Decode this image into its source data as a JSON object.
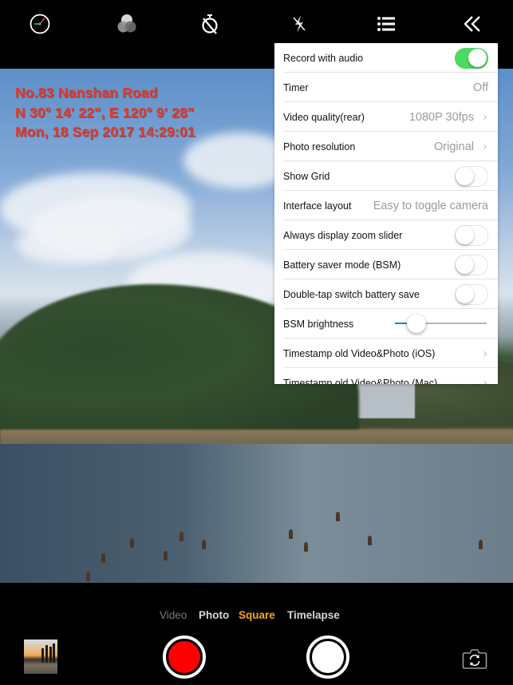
{
  "toolbar": {
    "icons": [
      "level-gauge-icon",
      "color-filter-icon",
      "timer-off-icon",
      "flash-off-icon",
      "settings-list-icon",
      "collapse-chevrons-icon"
    ]
  },
  "stamp": {
    "line1": "No.83 Nanshan Road",
    "line2": "N 30° 14' 22\", E 120° 9' 28\"",
    "line3": "Mon, 18 Sep 2017 14:29:01",
    "color": "#e23a2c"
  },
  "settings": {
    "items": [
      {
        "label": "Record with audio",
        "type": "toggle",
        "on": true
      },
      {
        "label": "Timer",
        "type": "value",
        "value": "Off"
      },
      {
        "label": "Video quality(rear)",
        "type": "value-chevron",
        "value": "1080P 30fps"
      },
      {
        "label": "Photo resolution",
        "type": "value-chevron",
        "value": "Original"
      },
      {
        "label": "Show Grid",
        "type": "toggle",
        "on": false
      },
      {
        "label": "Interface layout",
        "type": "value",
        "value": "Easy to toggle camera"
      },
      {
        "label": "Always display zoom slider",
        "type": "toggle",
        "on": false
      },
      {
        "label": "Battery saver mode (BSM)",
        "type": "toggle",
        "on": false
      },
      {
        "label": "Double-tap switch battery save",
        "type": "toggle",
        "on": false
      },
      {
        "label": "BSM brightness",
        "type": "slider",
        "value": 0.17
      },
      {
        "label": "Timestamp old Video&Photo (iOS)",
        "type": "chevron"
      },
      {
        "label": "Timestamp old Video&Photo (Mac)",
        "type": "chevron"
      }
    ],
    "toggle_on_color": "#4cd964",
    "slider_color": "#1a7cf5"
  },
  "modes": {
    "items": [
      "Video",
      "Photo",
      "Square",
      "Timelapse"
    ],
    "active": "Square",
    "active_color": "#f5a623"
  },
  "controls": {
    "record_color": "#ff0000",
    "shutter_color": "#ffffff"
  }
}
